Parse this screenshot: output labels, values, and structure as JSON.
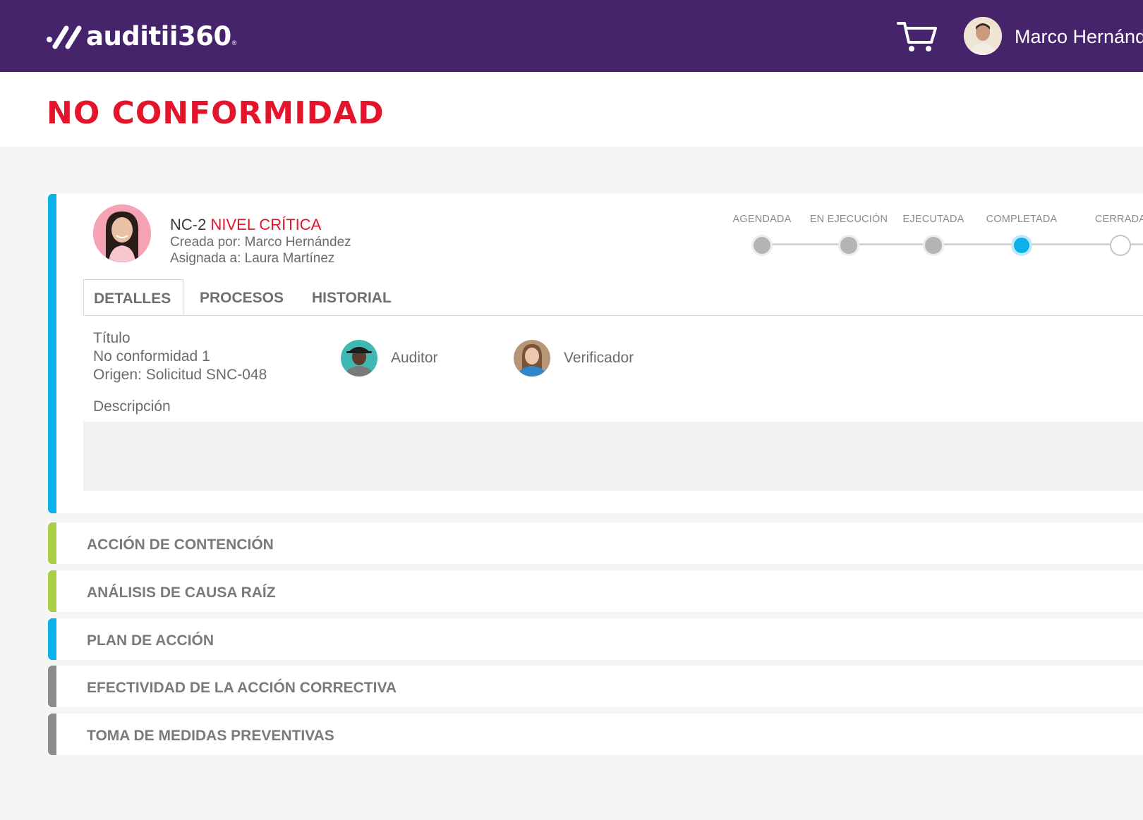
{
  "header": {
    "logo_text": "auditii360",
    "logo_reg": "®",
    "user_name": "Marco Hernández"
  },
  "page": {
    "title": "NO CONFORMIDAD"
  },
  "nc": {
    "code": "NC-2",
    "level": "NIVEL CRÍTICA",
    "created_by": "Creada por: Marco Hernández",
    "assigned_to": "Asignada a: Laura Martínez"
  },
  "stepper": {
    "steps": [
      {
        "label": "AGENDADA",
        "state": "done"
      },
      {
        "label": "EN EJECUCIÓN",
        "state": "done"
      },
      {
        "label": "EJECUTADA",
        "state": "done"
      },
      {
        "label": "COMPLETADA",
        "state": "active"
      },
      {
        "label": "CERRADA",
        "state": "pending"
      }
    ]
  },
  "tabs": [
    {
      "label": "DETALLES",
      "active": true
    },
    {
      "label": "PROCESOS",
      "active": false
    },
    {
      "label": "HISTORIAL",
      "active": false
    }
  ],
  "details": {
    "title_label": "Título",
    "title_value": "No conformidad 1",
    "origin": "Origen: Solicitud SNC-048",
    "auditor_label": "Auditor",
    "verifier_label": "Verificador",
    "description_label": "Descripción",
    "description_value": ""
  },
  "sections": [
    {
      "label": "ACCIÓN DE CONTENCIÓN",
      "color": "#a8cf45"
    },
    {
      "label": "ANÁLISIS DE CAUSA RAÍZ",
      "color": "#a8cf45"
    },
    {
      "label": "PLAN DE ACCIÓN",
      "color": "#0db1ea"
    },
    {
      "label": "EFECTIVIDAD DE LA ACCIÓN CORRECTIVA",
      "color": "#8c8c8c"
    },
    {
      "label": "TOMA DE MEDIDAS PREVENTIVAS",
      "color": "#8c8c8c"
    }
  ],
  "colors": {
    "header_bg": "#45246b",
    "title_red": "#e4142b",
    "accent_blue": "#0db1ea",
    "accent_green": "#a8cf45",
    "accent_gray": "#8c8c8c"
  }
}
